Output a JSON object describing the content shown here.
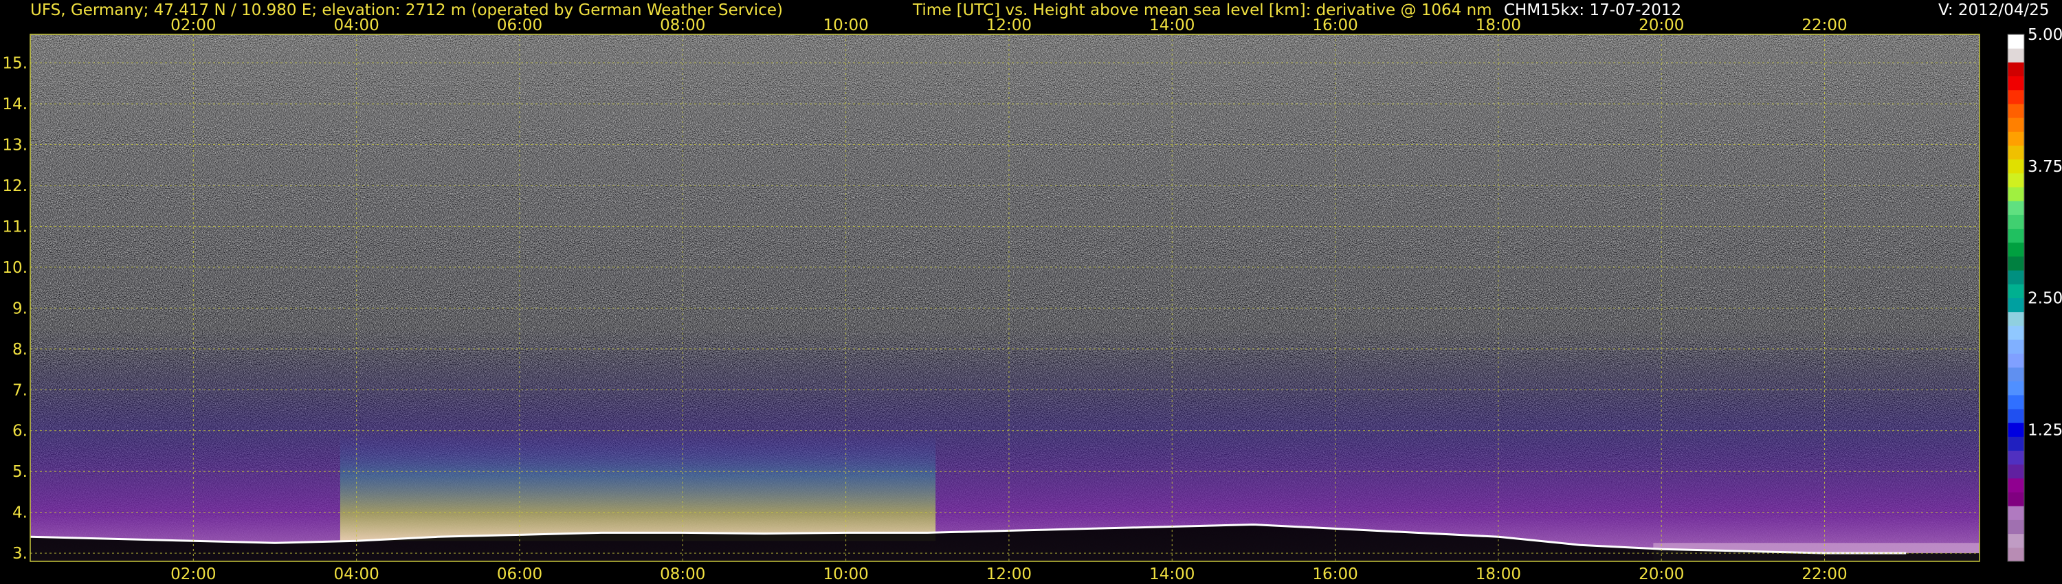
{
  "header": {
    "site": "UFS, Germany; 47.417 N / 10.980 E; elevation: 2712 m  (operated by German Weather Service)",
    "axes_title": "Time [UTC] vs. Height above mean sea level [km]: derivative @ 1064 nm",
    "instrument_date": "CHM15kx: 17-07-2012",
    "version": "V: 2012/04/25"
  },
  "colors": {
    "background": "#000000",
    "header_text": "#f0e040",
    "grid": "#c8c83c",
    "tick_text": "#f0e040",
    "colorbar_text": "#ffffff"
  },
  "chart_data": {
    "type": "heatmap",
    "x_unit": "UTC",
    "y_unit": "km above mean sea level",
    "xlim": [
      0.0,
      23.9
    ],
    "ylim": [
      2.8,
      15.7
    ],
    "x_ticks": [
      "02:00",
      "04:00",
      "06:00",
      "08:00",
      "10:00",
      "12:00",
      "14:00",
      "16:00",
      "18:00",
      "20:00",
      "22:00"
    ],
    "x_tick_values": [
      2,
      4,
      6,
      8,
      10,
      12,
      14,
      16,
      18,
      20,
      22
    ],
    "y_ticks": [
      "3.",
      "4.",
      "5.",
      "6.",
      "7.",
      "8.",
      "9.",
      "10.",
      "11.",
      "12.",
      "13.",
      "14.",
      "15."
    ],
    "y_tick_values": [
      3,
      4,
      5,
      6,
      7,
      8,
      9,
      10,
      11,
      12,
      13,
      14,
      15
    ],
    "grid": true,
    "colorbar": {
      "range": [
        0,
        5.0
      ],
      "tick_labels": [
        "5.00",
        "3.75",
        "2.50",
        "1.25"
      ],
      "tick_values": [
        5.0,
        3.75,
        2.5,
        1.25
      ],
      "colors": [
        "#b88cb4",
        "#c09cc4",
        "#a070b0",
        "#b07ac0",
        "#800080",
        "#900090",
        "#6020a0",
        "#5030c0",
        "#2020c0",
        "#0000e0",
        "#2050f0",
        "#3070ff",
        "#5090ff",
        "#6090f0",
        "#80a0ff",
        "#80b0ff",
        "#90c8ff",
        "#90d0e0",
        "#00a0a0",
        "#00b090",
        "#009080",
        "#008040",
        "#00a040",
        "#20c060",
        "#40d070",
        "#60e080",
        "#a0f040",
        "#d0f020",
        "#e0e000",
        "#f0c000",
        "#ffa000",
        "#ff8000",
        "#ff6000",
        "#ff3000",
        "#f00000",
        "#d00000",
        "#e0d8d8",
        "#ffffff"
      ]
    },
    "features": {
      "surface_layer_top_km": [
        3.4,
        3.35,
        3.3,
        3.25,
        3.3,
        3.4,
        3.45,
        3.5,
        3.5,
        3.48,
        3.5,
        3.5,
        3.55,
        3.6,
        3.65,
        3.7,
        3.6,
        3.5,
        3.4,
        3.2,
        3.1,
        3.05,
        3.0,
        3.0
      ]
    }
  }
}
